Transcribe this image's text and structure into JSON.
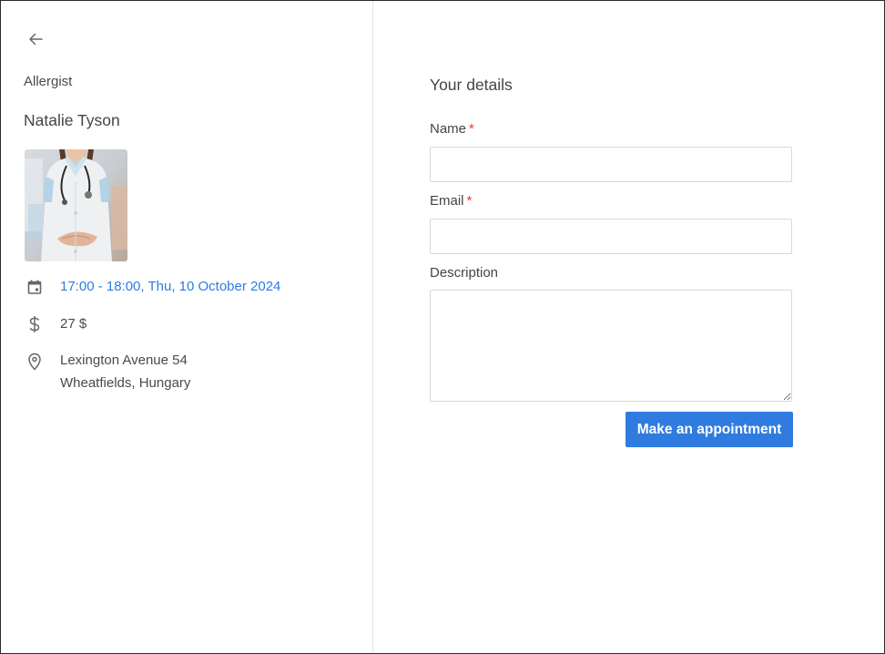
{
  "doctor": {
    "specialty": "Allergist",
    "name": "Natalie Tyson",
    "photo_alt": "Natalie Tyson"
  },
  "appointment": {
    "datetime": "17:00 - 18:00, Thu, 10 October 2024",
    "price": "27 $",
    "address_line1": "Lexington Avenue 54",
    "address_line2": "Wheatfields, Hungary"
  },
  "form": {
    "title": "Your details",
    "name_label": "Name",
    "email_label": "Email",
    "description_label": "Description",
    "required_marker": "*",
    "name_value": "",
    "email_value": "",
    "description_value": "",
    "submit_label": "Make an appointment"
  },
  "icons": {
    "back": "arrow-left-icon",
    "date": "calendar-icon",
    "price": "dollar-icon",
    "location": "map-pin-icon"
  },
  "colors": {
    "accent": "#2f7be0",
    "required": "#e53935",
    "text": "#444444",
    "border": "#d8d8d8"
  }
}
